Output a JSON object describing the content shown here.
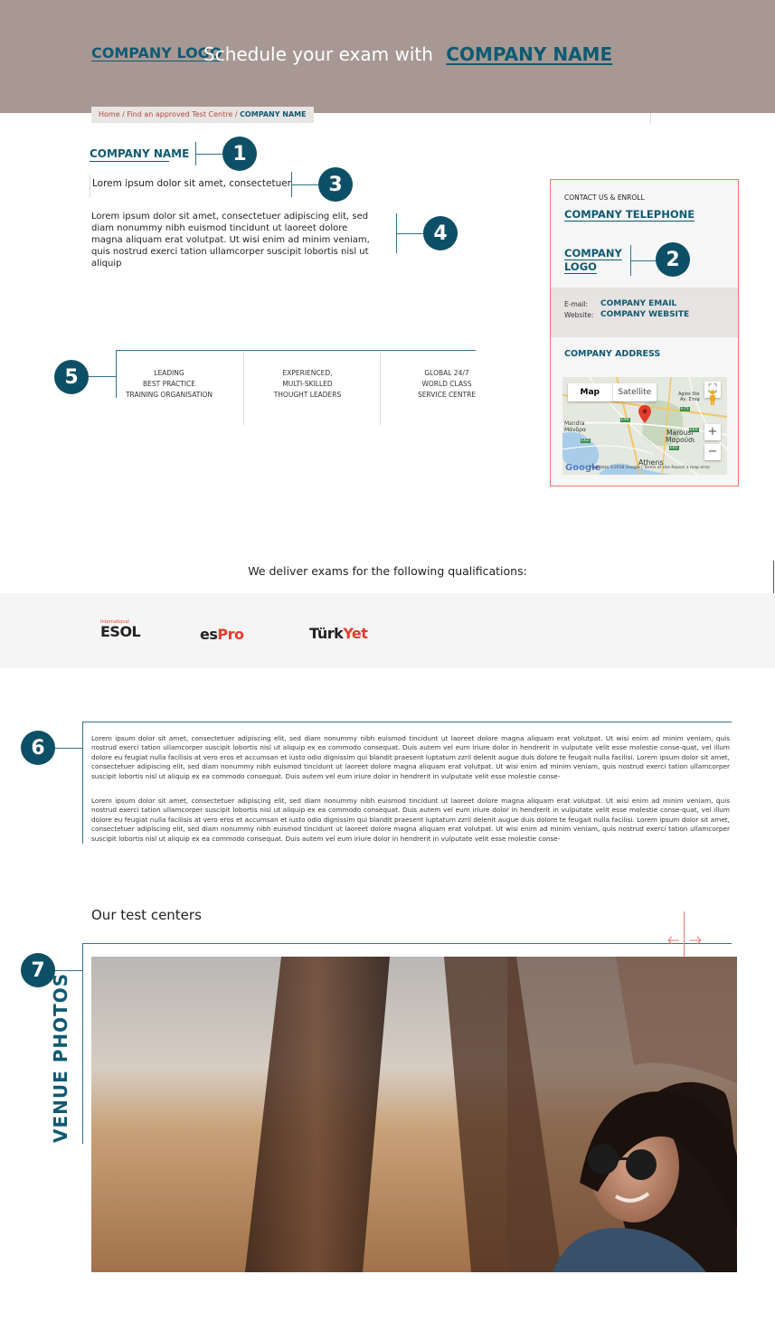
{
  "header": {
    "logo": "COMPANY LOGO",
    "title": "Schedule your exam with",
    "company": "COMPANY NAME"
  },
  "breadcrumb": {
    "home": "Home",
    "separator": "/",
    "find": "Find an approved Test Centre",
    "current": "COMPANY NAME"
  },
  "markers": [
    "1",
    "2",
    "3",
    "4",
    "5",
    "6",
    "7"
  ],
  "info": {
    "company_name": "COMPANY NAME",
    "tagline": "Lorem ipsum dolor sit amet, consectetuer",
    "description": "Lorem ipsum dolor sit amet, consectetuer adipiscing elit, sed diam nonummy nibh euismod tincidunt ut laoreet dolore magna aliquam erat volutpat. Ut wisi enim ad minim veniam, quis nostrud exerci tation ullamcorper suscipit lobortis nisl ut aliquip"
  },
  "features": [
    {
      "l1": "LEADING",
      "l2": "BEST PRACTICE",
      "l3": "TRAINING ORGANISATION"
    },
    {
      "l1": "EXPERIENCED,",
      "l2": "MULTI-SKILLED",
      "l3": "THOUGHT LEADERS"
    },
    {
      "l1": "GLOBAL 24/7",
      "l2": "WORLD CLASS",
      "l3": "SERVICE CENTRE"
    }
  ],
  "contact": {
    "heading": "CONTACT US & ENROLL",
    "telephone": "COMPANY TELEPHONE",
    "logo": "COMPANY LOGO",
    "email_label": "E-mail:",
    "email_value": "COMPANY EMAIL",
    "website_label": "Website:",
    "website_value": "COMPANY WEBSITE",
    "address": "COMPANY ADDRESS"
  },
  "map": {
    "map_tab": "Map",
    "satellite_tab": "Satellite",
    "zoom_in": "+",
    "zoom_out": "−",
    "google": "Google",
    "footer": "Map data ©2018 Google | Terms of Use    Report a map error",
    "places": [
      "Mandra",
      "Μάνδρα",
      "Marousi",
      "Μαρούσι",
      "Athens",
      "Agios Ste",
      "Αγ. Στέφ",
      "E94",
      "E75",
      "E65",
      "E62",
      "E65"
    ]
  },
  "qualifications": {
    "heading": "We deliver exams for the following qualifications:",
    "logos": [
      {
        "small": "International",
        "main": "ESOL"
      },
      {
        "prefix": "es",
        "suffix": "Pro"
      },
      {
        "prefix": "Türk",
        "suffix": "Yet"
      }
    ]
  },
  "paragraphs": [
    "Lorem ipsum dolor sit amet, consectetuer adipiscing elit, sed diam nonummy nibh euismod tincidunt ut laoreet dolore magna aliquam erat volutpat. Ut wisi enim ad minim veniam, quis nostrud exerci tation ullamcorper suscipit lobortis nisl ut aliquip ex ea commodo consequat. Duis autem vel eum iriure dolor in hendrerit in vulputate velit esse molestie conse-quat, vel illum dolore eu feugiat nulla facilisis at vero eros et accumsan et iusto odio dignissim qui blandit praesent luptatum zzril delenit augue duis dolore te feugait nulla facilisi. Lorem ipsum dolor sit amet, consectetuer adipiscing elit, sed diam nonummy nibh euismod tincidunt ut laoreet dolore magna aliquam erat volutpat. Ut wisi enim ad minim veniam, quis nostrud exerci tation ullamcorper suscipit lobortis nisl ut aliquip ex ea commodo consequat. Duis autem vel eum iriure dolor in hendrerit in vulputate velit esse molestie conse-",
    "Lorem ipsum dolor sit amet, consectetuer adipiscing elit, sed diam nonummy nibh euismod tincidunt ut laoreet dolore magna aliquam erat volutpat. Ut wisi enim ad minim veniam, quis nostrud exerci tation ullamcorper suscipit lobortis nisl ut aliquip ex ea commodo consequat. Duis autem vel eum iriure dolor in hendrerit in vulputate velit esse molestie conse-quat, vel illum dolore eu feugiat nulla facilisis at vero eros et accumsan et iusto odio dignissim qui blandit praesent luptatum zzril delenit augue duis dolore te feugait nulla facilisi. Lorem ipsum dolor sit amet, consectetuer adipiscing elit, sed diam nonummy nibh euismod tincidunt ut laoreet dolore magna aliquam erat volutpat. Ut wisi enim ad minim veniam, quis nostrud exerci tation ullamcorper suscipit lobortis nisl ut aliquip ex ea commodo consequat. Duis autem vel eum iriure dolor in hendrerit in vulputate velit esse molestie conse-"
  ],
  "centers": {
    "heading": "Our test centers",
    "venue_label": "VENUE PHOTOS"
  },
  "colors": {
    "header_bg": "#a89893",
    "brand_teal": "#0f5a72",
    "badge": "#0d4f66",
    "panel_border": "#e8776a",
    "accent_red": "#e53b2c"
  }
}
